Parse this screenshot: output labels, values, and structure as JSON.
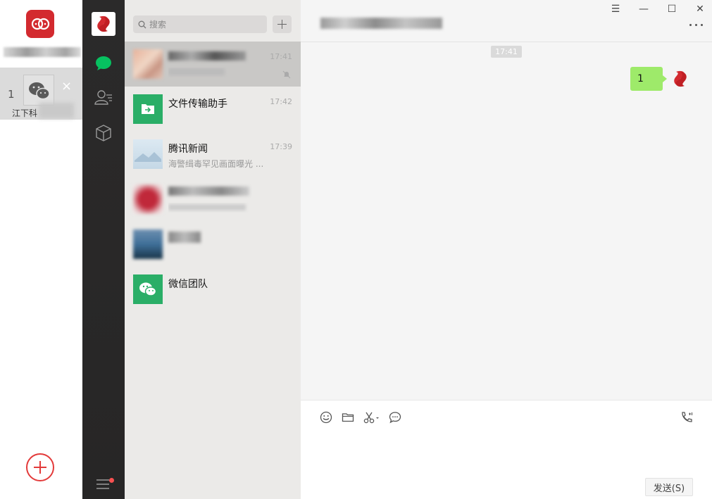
{
  "accounts": {
    "current_index": "1",
    "current_name": "江下科",
    "close_glyph": "×"
  },
  "nav": {
    "items": [
      "chat-icon",
      "contacts-icon",
      "favorites-icon"
    ],
    "menu_has_badge": true
  },
  "search": {
    "placeholder": "搜索"
  },
  "conversations": [
    {
      "name": "",
      "time": "17:41",
      "preview": "",
      "selected": true,
      "muted": true
    },
    {
      "name": "文件传输助手",
      "time": "17:42",
      "preview": ""
    },
    {
      "name": "腾讯新闻",
      "time": "17:39",
      "preview": "海警缉毒罕见画面曝光 ..."
    },
    {
      "name": "",
      "time": "",
      "preview": ""
    },
    {
      "name": "",
      "time": "",
      "preview": ""
    },
    {
      "name": "微信团队",
      "time": "",
      "preview": ""
    }
  ],
  "chat": {
    "title": "",
    "timestamp": "17:41",
    "messages": [
      {
        "text": "1",
        "from": "me"
      }
    ],
    "send_label": "发送(S)"
  },
  "window_controls": {
    "menu": "☰",
    "minimize": "—",
    "maximize": "☐",
    "close": "✕"
  },
  "colors": {
    "bubble": "#9eea6a",
    "nav_active": "#07c160",
    "brand_red": "#d32a2f",
    "file_helper": "#2aae67"
  }
}
